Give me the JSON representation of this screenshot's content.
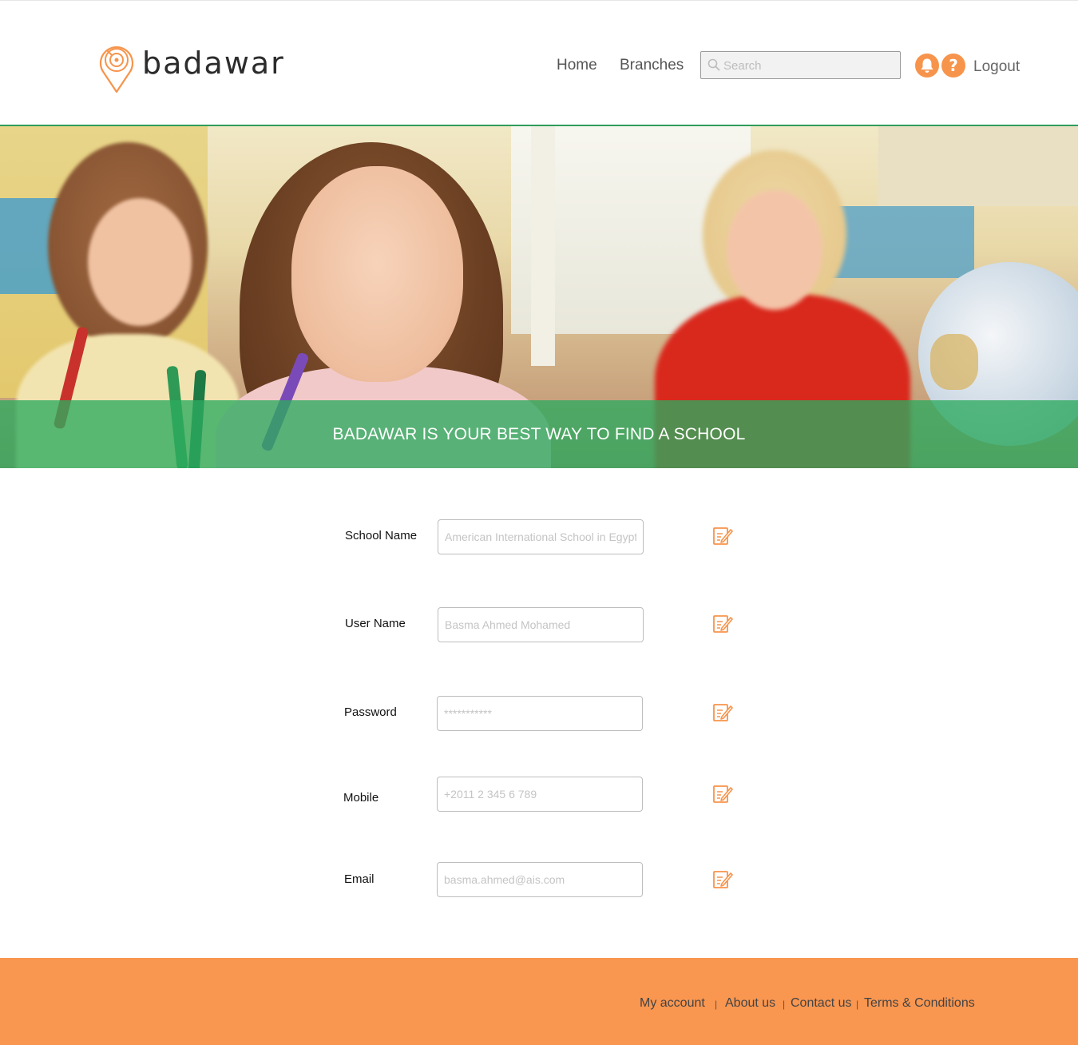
{
  "brand": {
    "name": "badawar",
    "accent": "#f7944b",
    "green": "#2daa5f"
  },
  "nav": {
    "home": "Home",
    "branches": "Branches",
    "search_placeholder": "Search",
    "notifications_icon": "bell-icon",
    "help_icon": "question-icon",
    "help_glyph": "?",
    "logout": "Logout"
  },
  "hero": {
    "title": "BADAWAR IS YOUR BEST WAY TO FIND A SCHOOL"
  },
  "form": {
    "school_name": {
      "label": "School Name",
      "placeholder": "American International School in Egypt"
    },
    "user_name": {
      "label": "User Name",
      "placeholder": "Basma Ahmed Mohamed"
    },
    "password": {
      "label": "Password",
      "placeholder": "***********"
    },
    "mobile": {
      "label": "Mobile",
      "placeholder": "+2011 2 345 6 789"
    },
    "email": {
      "label": "Email",
      "placeholder": "basma.ahmed@ais.com"
    },
    "edit_icon": "edit-icon"
  },
  "footer": {
    "links": [
      "My account",
      "About us",
      "Contact us",
      "Terms & Conditions"
    ],
    "separator": "|"
  }
}
